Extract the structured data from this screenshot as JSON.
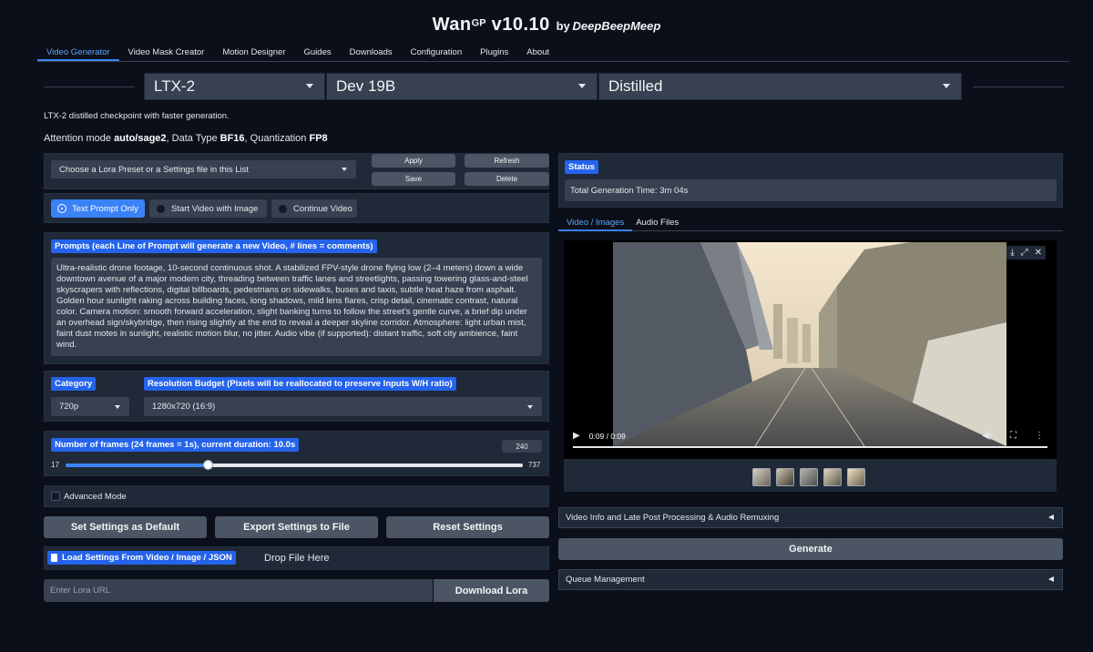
{
  "app": {
    "title": "Wan",
    "title_sup": "GP",
    "version": " v10.10",
    "by": "by",
    "author": "DeepBeepMeep"
  },
  "tabs": [
    {
      "label": "Video Generator",
      "active": true
    },
    {
      "label": "Video Mask Creator"
    },
    {
      "label": "Motion Designer"
    },
    {
      "label": "Guides"
    },
    {
      "label": "Downloads"
    },
    {
      "label": "Configuration"
    },
    {
      "label": "Plugins"
    },
    {
      "label": "About"
    }
  ],
  "model": {
    "family": "LTX-2",
    "version": "Dev 19B",
    "variant": "Distilled",
    "description": "LTX-2 distilled checkpoint with faster generation.",
    "attn_prefix": "Attention mode ",
    "attn_mode": "auto/sage2",
    "dtype_prefix": ", Data Type ",
    "dtype": "BF16",
    "quant_prefix": ", Quantization ",
    "quant": "FP8"
  },
  "lora": {
    "preset_placeholder": "Choose a Lora Preset or a Settings file in this List",
    "apply": "Apply",
    "refresh": "Refresh",
    "save": "Save",
    "delete": "Delete",
    "url_placeholder": "Enter Lora URL",
    "download": "Download Lora"
  },
  "mode": {
    "options": [
      "Text Prompt Only",
      "Start Video with Image",
      "Continue Video"
    ],
    "selected": "Text Prompt Only"
  },
  "prompt": {
    "label": "Prompts (each Line of Prompt will generate a new Video, # lines = comments)",
    "text": "Ultra-realistic drone footage, 10-second continuous shot. A stabilized FPV-style drone flying low (2–4 meters) down a wide downtown avenue of a major modern city, threading between traffic lanes and streetlights, passing towering glass-and-steel skyscrapers with reflections, digital billboards, pedestrians on sidewalks, buses and taxis, subtle heat haze from asphalt. Golden hour sunlight raking across building faces, long shadows, mild lens flares, crisp detail, cinematic contrast, natural color. Camera motion: smooth forward acceleration, slight banking turns to follow the street’s gentle curve, a brief dip under an overhead sign/skybridge, then rising slightly at the end to reveal a deeper skyline corridor. Atmosphere: light urban mist, faint dust motes in sunlight, realistic motion blur, no jitter. Audio vibe (if supported): distant traffic, soft city ambience, faint wind."
  },
  "category": {
    "label": "Category",
    "value": "720p"
  },
  "resolution": {
    "label": "Resolution Budget (Pixels will be reallocated to preserve Inputs W/H ratio)",
    "value": "1280x720 (16:9)"
  },
  "frames": {
    "label": "Number of frames (24 frames = 1s), current duration: 10.0s",
    "value": "240",
    "min": "17",
    "max": "737",
    "fraction": 0.311
  },
  "advanced": {
    "label": "Advanced Mode",
    "checked": false
  },
  "settings_buttons": {
    "set_default": "Set Settings as Default",
    "export": "Export Settings to File",
    "reset": "Reset Settings"
  },
  "load": {
    "label": "Load Settings From Video / Image / JSON",
    "drop": "Drop File Here"
  },
  "status": {
    "label": "Status",
    "text": "Total Generation Time: 3m 04s"
  },
  "output_tabs": [
    {
      "label": "Video / Images",
      "active": true
    },
    {
      "label": "Audio Files"
    }
  ],
  "player": {
    "time": "0:09 / 0:09",
    "progress": 1.0
  },
  "accordions": {
    "video_info": "Video Info and Late Post Processing & Audio Remuxing",
    "queue": "Queue Management"
  },
  "generate": "Generate",
  "colors": {
    "background": "#0b0f19",
    "panel": "#1f2937",
    "accent": "#3b82f6",
    "input": "#374151"
  }
}
